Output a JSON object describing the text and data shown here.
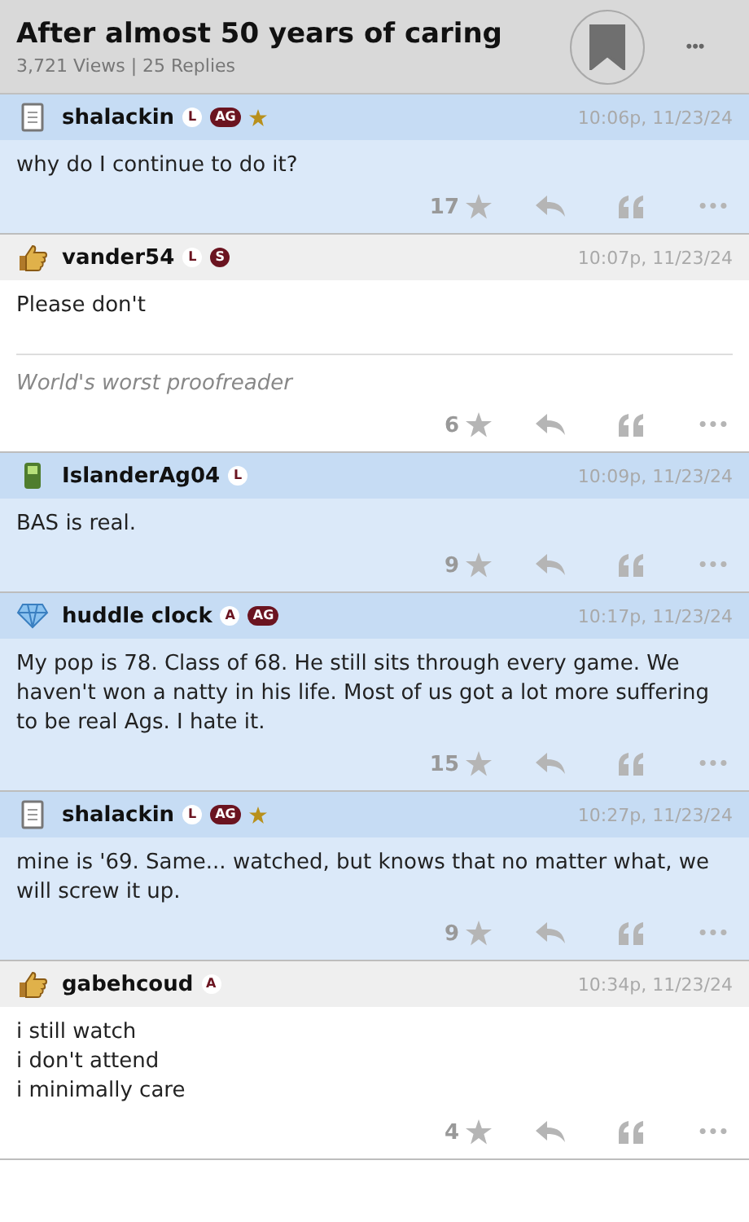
{
  "thread": {
    "title": "After almost 50 years of caring",
    "stats": "3,721 Views | 25 Replies",
    "bookmarked": true,
    "more": "•••"
  },
  "posts": [
    {
      "kind": "notepad",
      "username": "shalackin",
      "badges": [
        {
          "kind": "letter",
          "text": "L"
        },
        {
          "kind": "tag",
          "text": "AG"
        }
      ],
      "starred": true,
      "time": "10:06p, 11/23/24",
      "highlighted": true,
      "lines": [
        "why do I continue to do it?"
      ],
      "stars_count": "17",
      "more": "•••"
    },
    {
      "kind": "hand",
      "username": "vander54",
      "badges": [
        {
          "kind": "letter",
          "text": "L"
        },
        {
          "kind": "dark",
          "text": "S"
        }
      ],
      "starred": false,
      "time": "10:07p, 11/23/24",
      "highlighted": false,
      "lines": [
        "Please don't"
      ],
      "signature": "World's worst proofreader",
      "stars_count": "6",
      "more": "•••"
    },
    {
      "kind": "phone",
      "username": "IslanderAg04",
      "badges": [
        {
          "kind": "letter",
          "text": "L"
        }
      ],
      "starred": false,
      "time": "10:09p, 11/23/24",
      "highlighted": true,
      "lines": [
        "BAS is real."
      ],
      "stars_count": "9",
      "more": "•••"
    },
    {
      "kind": "diamond",
      "username": "huddle clock",
      "badges": [
        {
          "kind": "letter",
          "text": "A"
        },
        {
          "kind": "tag",
          "text": "AG"
        }
      ],
      "starred": false,
      "time": "10:17p, 11/23/24",
      "highlighted": true,
      "lines": [
        "My pop is 78. Class of 68. He still sits through every game. We haven't won a natty in his life. Most of us got a lot more suffering to be real Ags. I hate it."
      ],
      "stars_count": "15",
      "more": "•••"
    },
    {
      "kind": "notepad",
      "username": "shalackin",
      "badges": [
        {
          "kind": "letter",
          "text": "L"
        },
        {
          "kind": "tag",
          "text": "AG"
        }
      ],
      "starred": true,
      "time": "10:27p, 11/23/24",
      "highlighted": true,
      "lines": [
        "mine is '69. Same... watched, but knows that no matter what, we will screw it up."
      ],
      "stars_count": "9",
      "more": "•••"
    },
    {
      "kind": "hand",
      "username": "gabehcoud",
      "badges": [
        {
          "kind": "letter",
          "text": "A"
        }
      ],
      "starred": false,
      "time": "10:34p, 11/23/24",
      "highlighted": false,
      "lines": [
        "i still watch",
        "i don't attend",
        "i minimally care"
      ],
      "stars_count": "4",
      "more": "•••"
    }
  ]
}
